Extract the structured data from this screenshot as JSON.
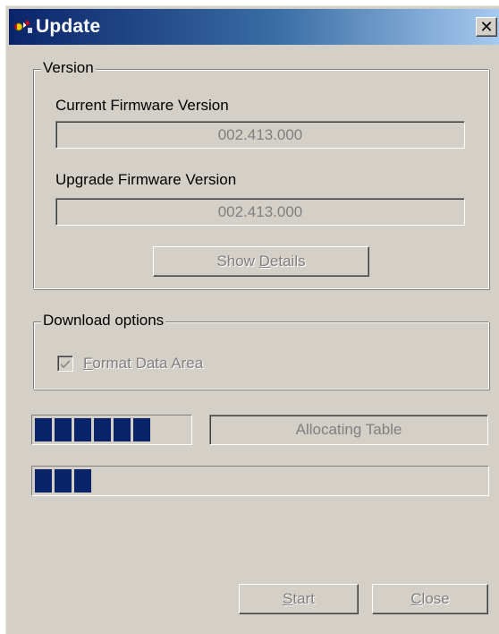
{
  "window": {
    "title": "Update",
    "close_label": "✕"
  },
  "version_group": {
    "label": "Version",
    "current_label": "Current Firmware Version",
    "current_value": "002.413.000",
    "upgrade_label": "Upgrade Firmware Version",
    "upgrade_value": "002.413.000",
    "show_details": {
      "prefix": "Show ",
      "mnemonic": "D",
      "suffix": "etails"
    }
  },
  "download_group": {
    "label": "Download options",
    "checkbox": {
      "checked": true,
      "mnemonic": "F",
      "suffix": "ormat Data Area"
    }
  },
  "progress": {
    "table_progress": 0.82,
    "status_text": "Allocating Table",
    "overall_progress": 0.12
  },
  "buttons": {
    "start": {
      "mnemonic": "S",
      "suffix": "tart"
    },
    "close": {
      "mnemonic": "C",
      "suffix": "lose"
    }
  },
  "colors": {
    "window_face": "#d4d0c8",
    "title_start": "#0a246a",
    "title_end": "#a6caf0",
    "progress_fill": "#0a246a",
    "disabled_text": "#808080"
  },
  "icons": {
    "title": "app-update-icon",
    "close": "close-icon",
    "check": "checkmark-icon"
  }
}
